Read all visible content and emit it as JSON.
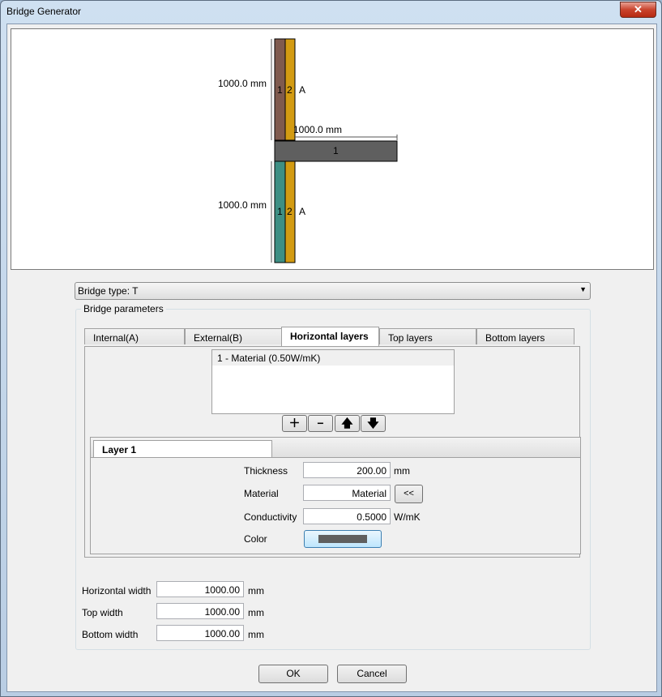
{
  "window": {
    "title": "Bridge Generator",
    "close_glyph": "✕"
  },
  "preview": {
    "dim_top": "1000.0 mm",
    "dim_bottom": "1000.0 mm",
    "dim_horizontal": "1000.0 mm",
    "layer_num_1": "1",
    "layer_num_2": "2",
    "side_label": "A",
    "horizontal_layer_num": "1",
    "colors": {
      "top_internal": "#7f5a4e",
      "bottom_internal": "#3e8f84",
      "external": "#d39b12",
      "horizontal": "#5f5f5f"
    }
  },
  "bridge_type": {
    "label": "Bridge type: T"
  },
  "params": {
    "group_label": "Bridge parameters",
    "tabs": [
      {
        "label": "Internal(A)"
      },
      {
        "label": "External(B)"
      },
      {
        "label": "Horizontal layers"
      },
      {
        "label": "Top layers"
      },
      {
        "label": "Bottom layers"
      }
    ],
    "active_tab": "Horizontal layers",
    "layers_list": [
      {
        "label": "1 - Material (0.50W/mK)"
      }
    ],
    "buttons": {
      "add_icon": "plus-icon",
      "remove_icon": "minus-icon",
      "up_icon": "arrow-up-icon",
      "down_icon": "arrow-down-icon"
    },
    "layer": {
      "tab_label": "Layer 1",
      "thickness_label": "Thickness",
      "thickness_value": "200.00",
      "thickness_unit": "mm",
      "material_label": "Material",
      "material_value": "Material",
      "material_button": "<<",
      "conductivity_label": "Conductivity",
      "conductivity_value": "0.5000",
      "conductivity_unit": "W/mK",
      "color_label": "Color",
      "color_value": "#5f5f5f"
    },
    "horizontal_width_label": "Horizontal width",
    "horizontal_width_value": "1000.00",
    "top_width_label": "Top width",
    "top_width_value": "1000.00",
    "bottom_width_label": "Bottom width",
    "bottom_width_value": "1000.00",
    "width_unit": "mm"
  },
  "dialog": {
    "ok": "OK",
    "cancel": "Cancel"
  }
}
